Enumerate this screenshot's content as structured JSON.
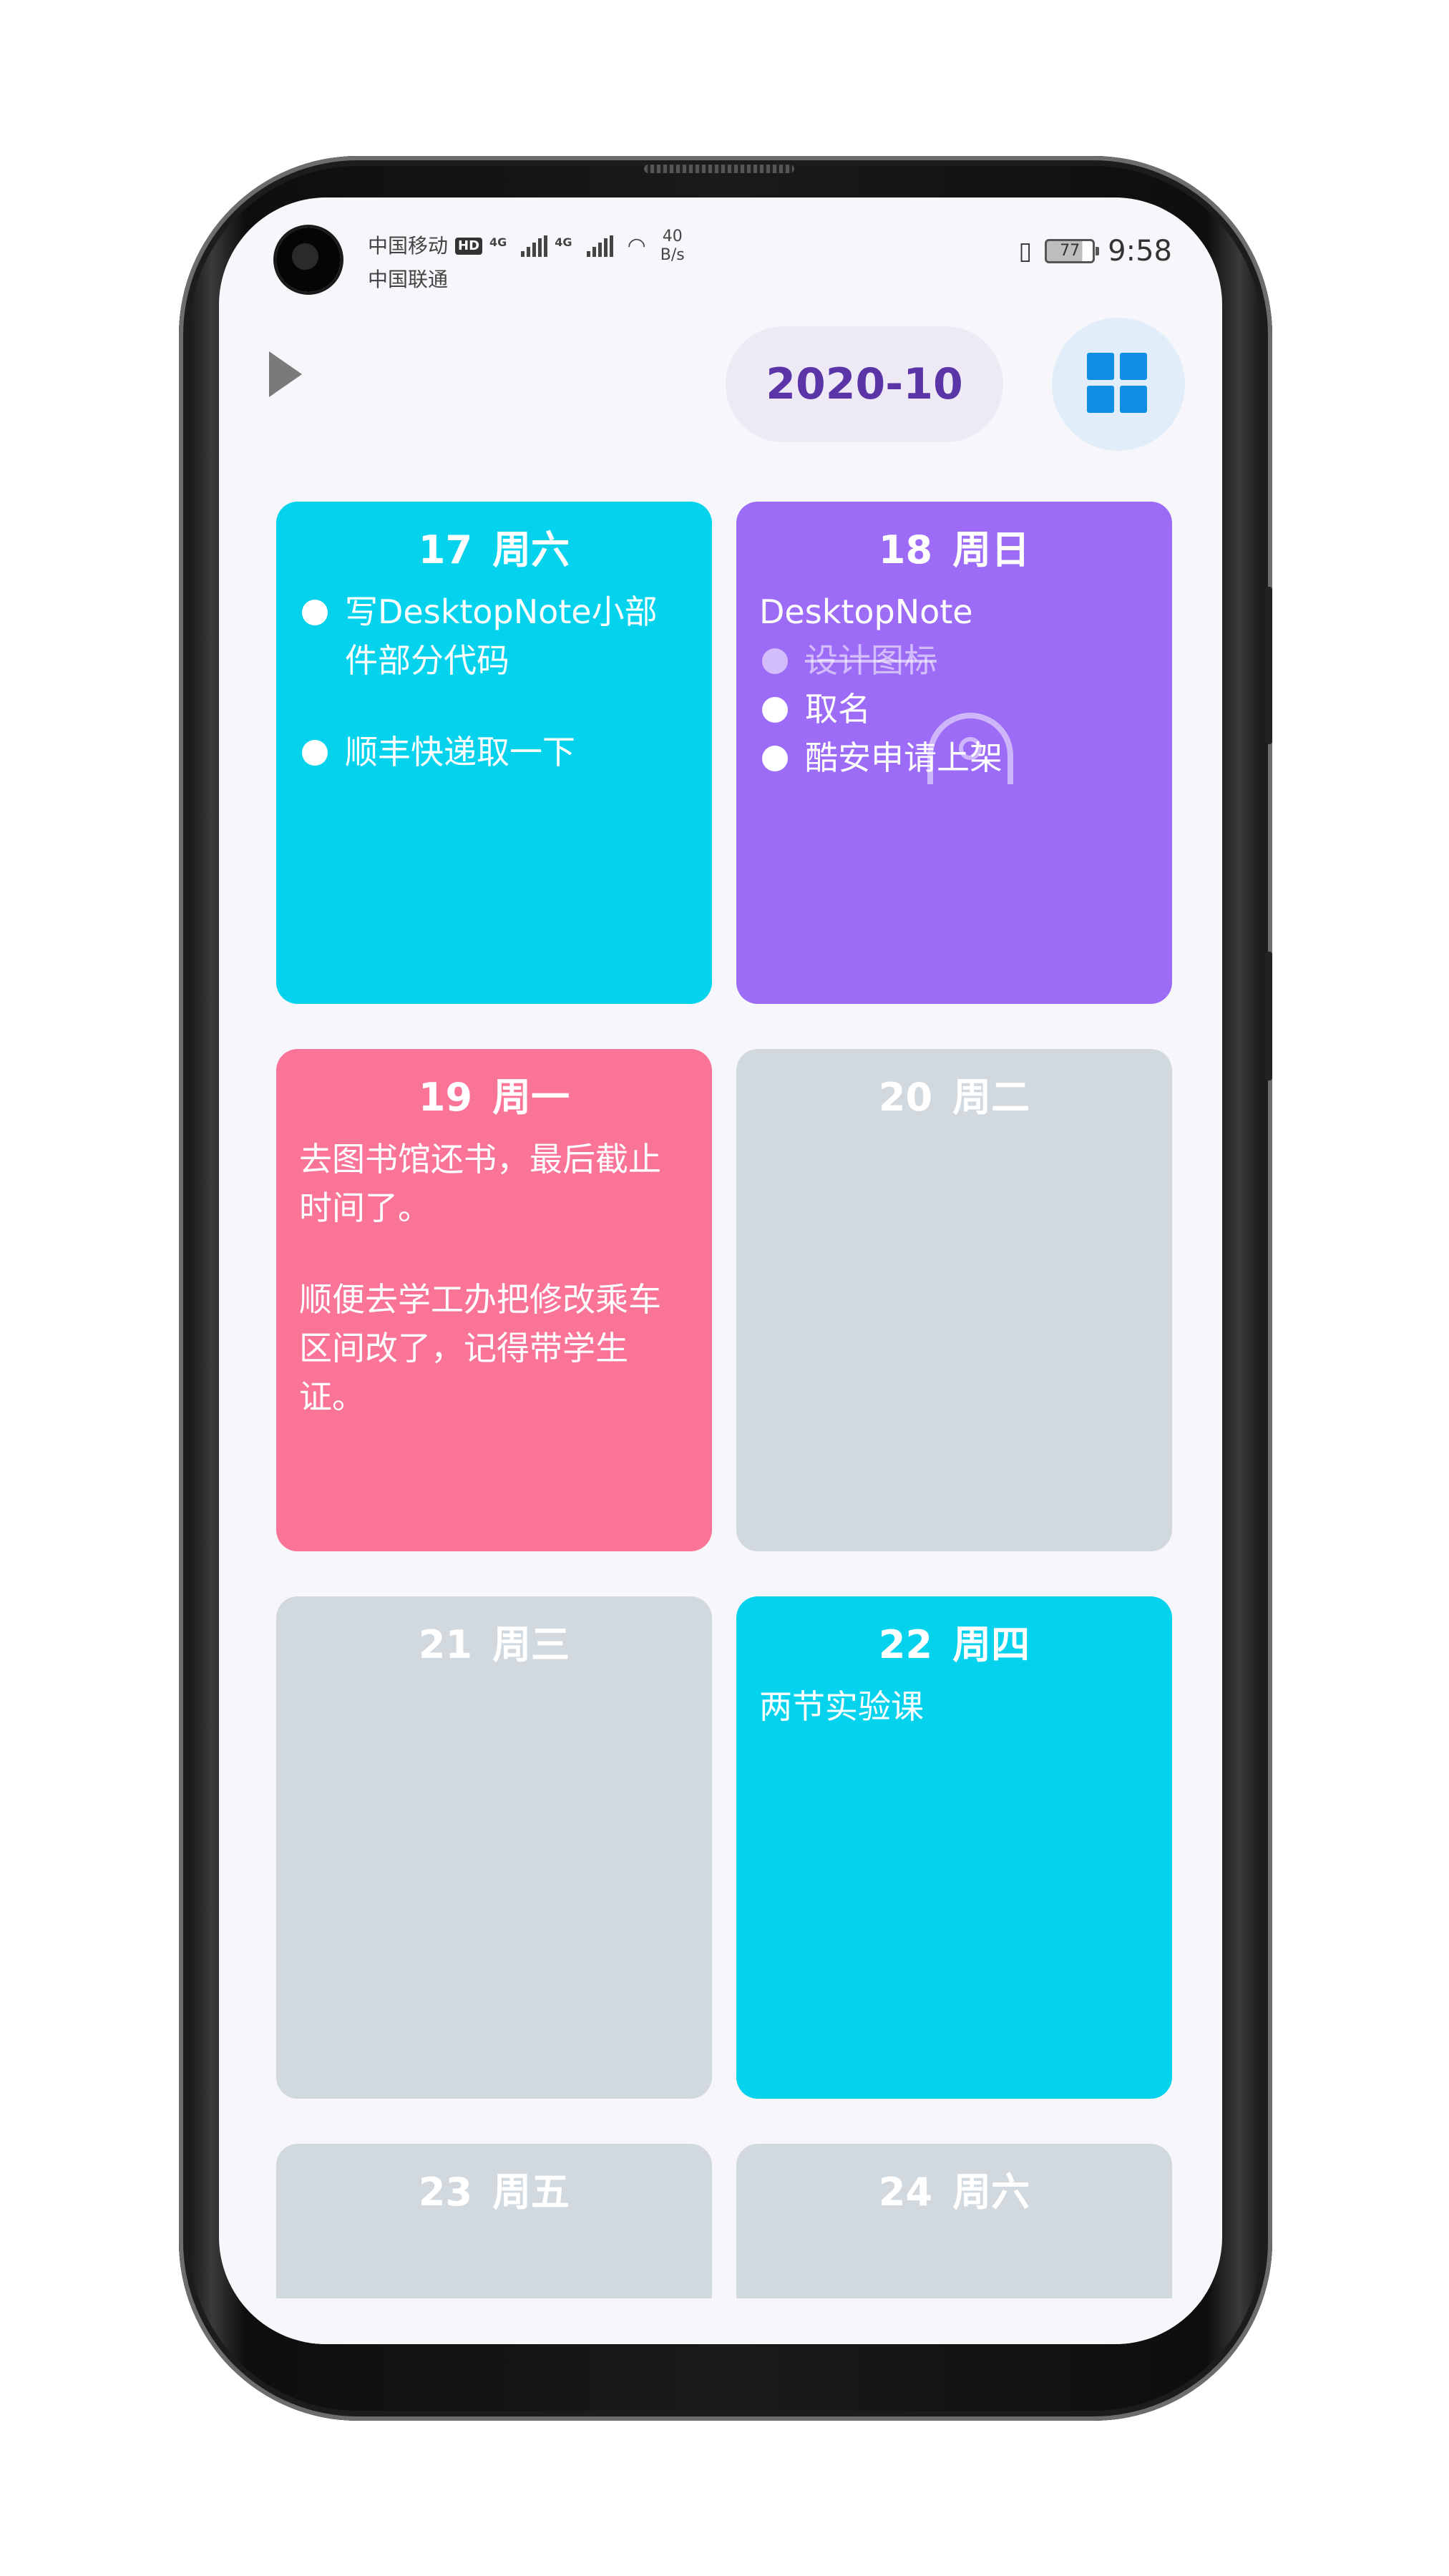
{
  "status_bar": {
    "carrier1": "中国移动",
    "hd": "HD",
    "carrier2": "中国联通",
    "net1": "4G",
    "net2": "4G",
    "speed_value": "40",
    "speed_unit": "B/s",
    "battery": "77",
    "time": "9:58"
  },
  "header": {
    "month": "2020-10"
  },
  "colors": {
    "cyan": "#05d3ed",
    "purple": "#9d6cf6",
    "pink": "#f97497",
    "grey": "#d1d9df",
    "month_text": "#5b35a8",
    "grid_icon": "#0f8fe4"
  },
  "days": [
    {
      "day": "17",
      "weekday": "周六",
      "items": [
        "写DesktopNote小部件部分代码",
        "顺丰快递取一下"
      ]
    },
    {
      "day": "18",
      "weekday": "周日",
      "heading": "DesktopNote",
      "items": [
        "设计图标",
        "取名",
        "酷安申请上架"
      ]
    },
    {
      "day": "19",
      "weekday": "周一",
      "paragraphs": [
        "去图书馆还书，最后截止时间了。",
        "顺便去学工办把修改乘车区间改了，记得带学生证。"
      ]
    },
    {
      "day": "20",
      "weekday": "周二"
    },
    {
      "day": "21",
      "weekday": "周三"
    },
    {
      "day": "22",
      "weekday": "周四",
      "paragraphs": [
        "两节实验课"
      ]
    },
    {
      "day": "23",
      "weekday": "周五"
    },
    {
      "day": "24",
      "weekday": "周六"
    }
  ]
}
